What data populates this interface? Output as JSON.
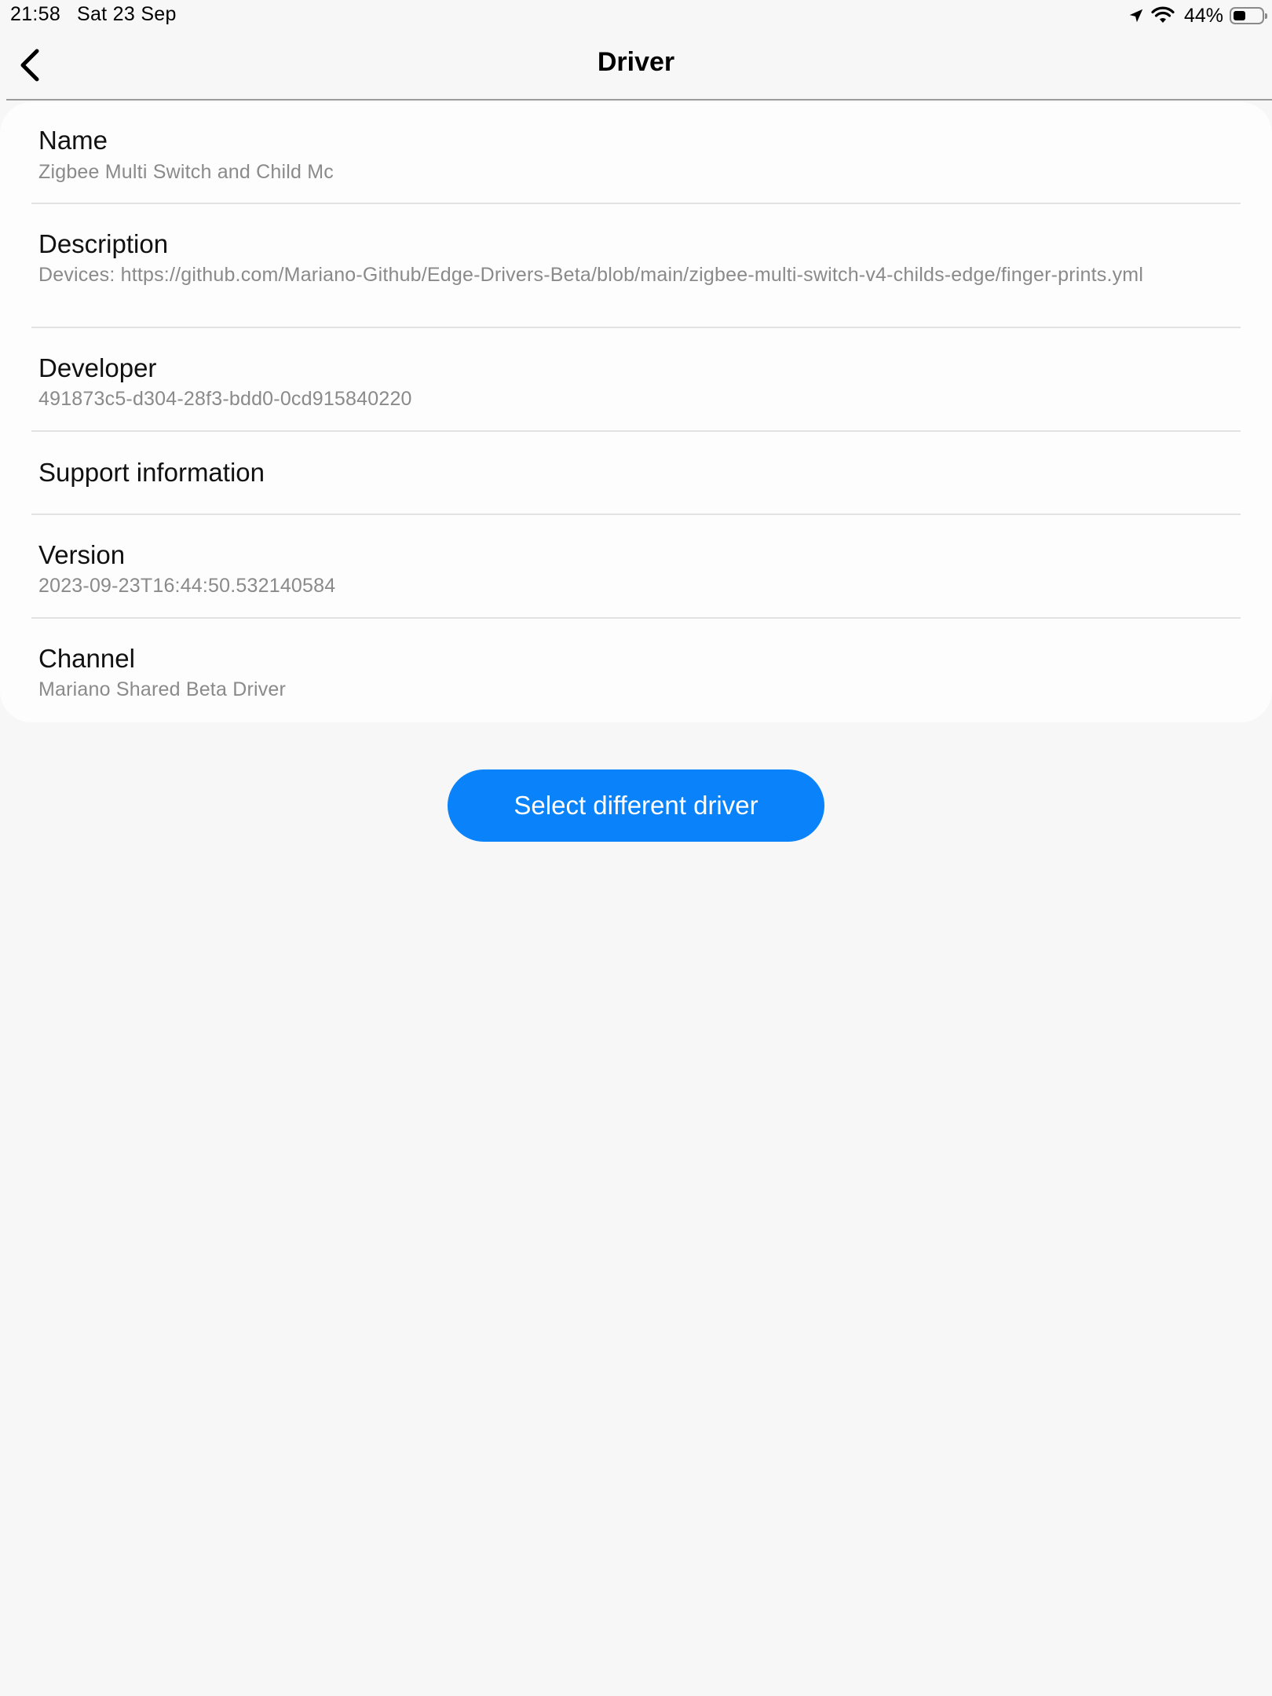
{
  "status_bar": {
    "time": "21:58",
    "date": "Sat 23 Sep",
    "battery_percent": "44%",
    "battery_level": 0.44,
    "icons": [
      "location-arrow-icon",
      "wifi-icon",
      "battery-icon"
    ]
  },
  "nav": {
    "title": "Driver",
    "back_icon": "chevron-left-icon"
  },
  "details": [
    {
      "label": "Name",
      "value": "Zigbee Multi Switch and Child Mc"
    },
    {
      "label": "Description",
      "value": "Devices: https://github.com/Mariano-Github/Edge-Drivers-Beta/blob/main/zigbee-multi-switch-v4-childs-edge/finger-prints.yml"
    },
    {
      "label": "Developer",
      "value": "491873c5-d304-28f3-bdd0-0cd915840220"
    },
    {
      "label": "Support information",
      "value": ""
    },
    {
      "label": "Version",
      "value": "2023-09-23T16:44:50.532140584"
    },
    {
      "label": "Channel",
      "value": "Mariano Shared Beta Driver"
    }
  ],
  "actions": {
    "select_driver_label": "Select different driver"
  },
  "colors": {
    "accent": "#0a82fa",
    "background": "#f7f7f7",
    "card": "#fdfdfd",
    "secondary_text": "#8a8a8a"
  }
}
